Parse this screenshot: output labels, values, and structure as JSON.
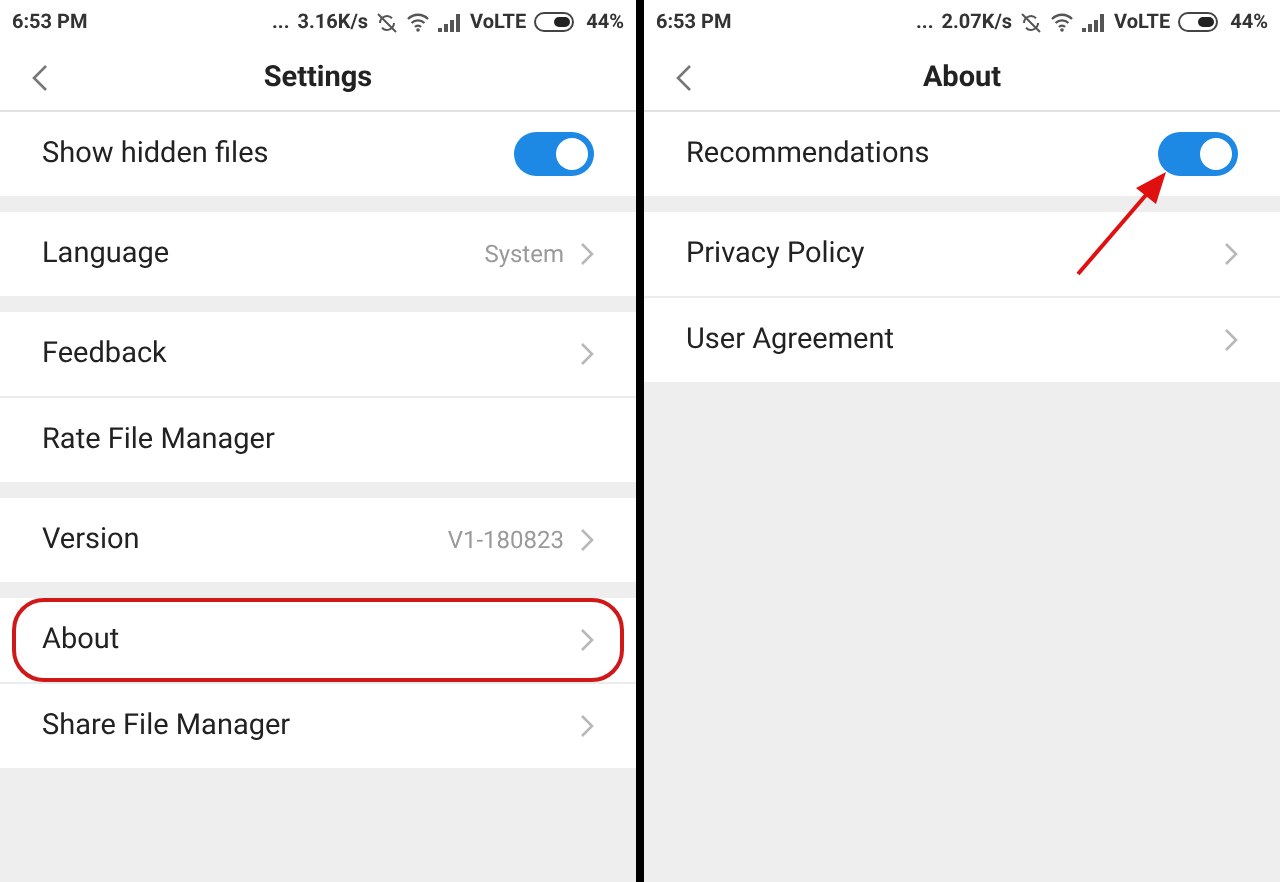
{
  "screens": [
    {
      "status_bar": {
        "time": "6:53 PM",
        "dots": "...",
        "speed": "3.16K/s",
        "network": "VoLTE",
        "battery": "44%"
      },
      "title": "Settings",
      "arrow": false,
      "groups": [
        [
          {
            "kind": "toggle",
            "label": "Show hidden files",
            "on": true,
            "highlighted": false
          }
        ],
        [
          {
            "kind": "link",
            "label": "Language",
            "value": "System",
            "highlighted": false
          }
        ],
        [
          {
            "kind": "link",
            "label": "Feedback",
            "highlighted": false
          },
          {
            "kind": "plain",
            "label": "Rate File Manager",
            "highlighted": false
          }
        ],
        [
          {
            "kind": "link",
            "label": "Version",
            "value": "V1-180823",
            "highlighted": false
          }
        ],
        [
          {
            "kind": "link",
            "label": "About",
            "highlighted": true
          },
          {
            "kind": "link",
            "label": "Share File Manager",
            "highlighted": false
          }
        ]
      ]
    },
    {
      "status_bar": {
        "time": "6:53 PM",
        "dots": "...",
        "speed": "2.07K/s",
        "network": "VoLTE",
        "battery": "44%"
      },
      "title": "About",
      "arrow": true,
      "groups": [
        [
          {
            "kind": "toggle",
            "label": "Recommendations",
            "on": true,
            "highlighted": false
          }
        ],
        [
          {
            "kind": "link",
            "label": "Privacy Policy",
            "highlighted": false
          },
          {
            "kind": "link",
            "label": "User Agreement",
            "highlighted": false
          }
        ]
      ]
    }
  ]
}
